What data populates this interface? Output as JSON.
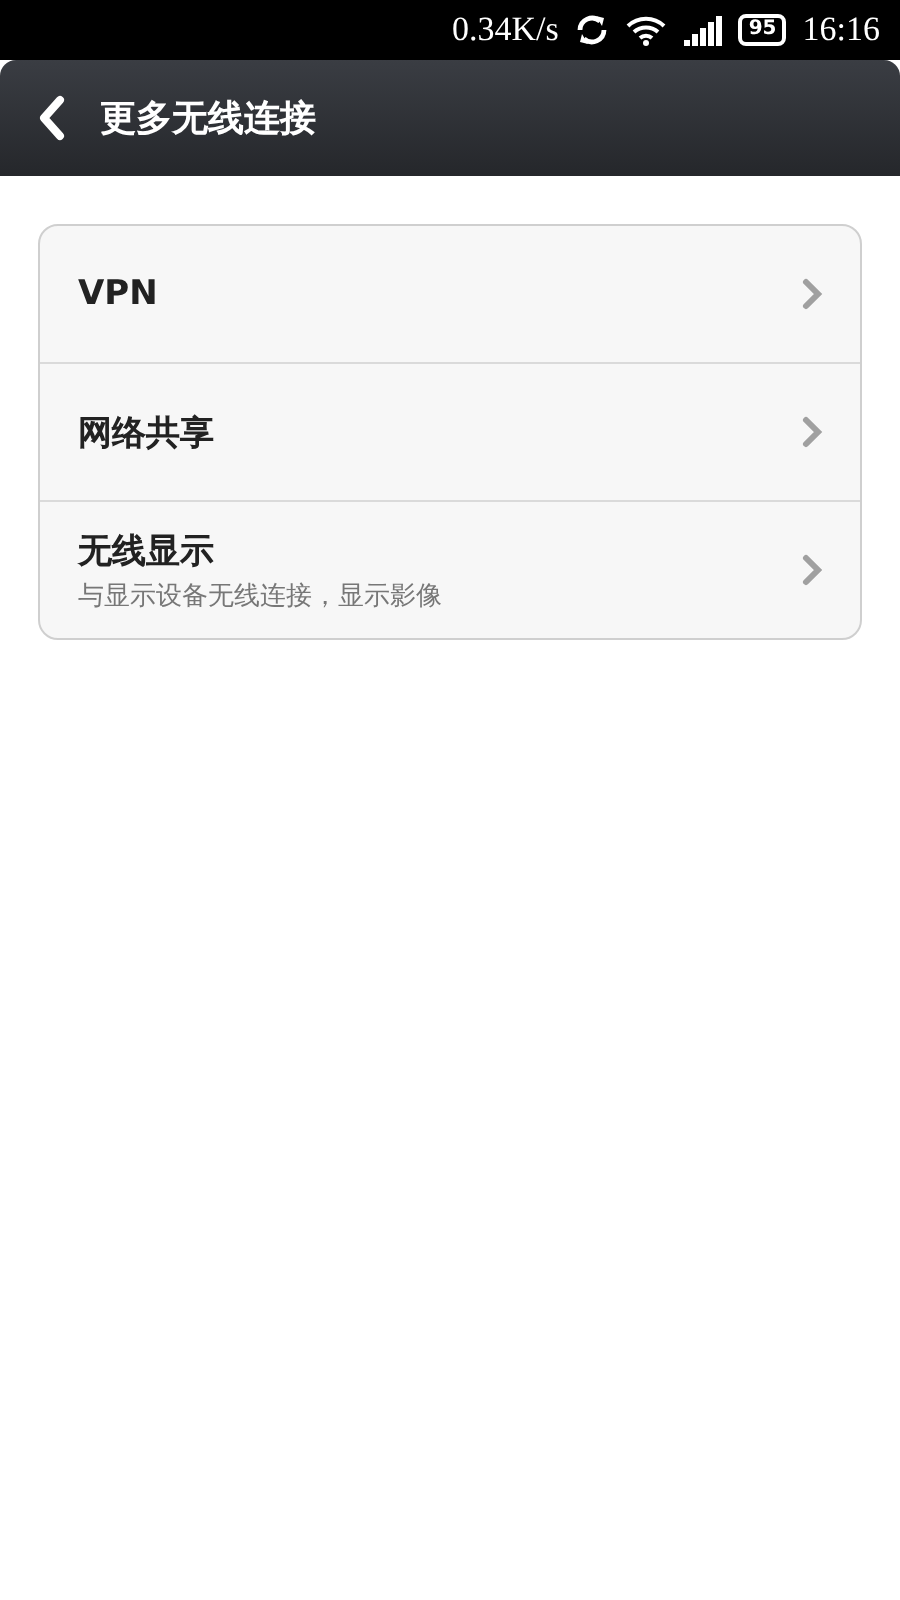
{
  "status_bar": {
    "speed": "0.34K/s",
    "battery": "95",
    "time": "16:16"
  },
  "header": {
    "title": "更多无线连接"
  },
  "items": [
    {
      "title": "VPN"
    },
    {
      "title": "网络共享"
    },
    {
      "title": "无线显示",
      "subtitle": "与显示设备无线连接，显示影像"
    }
  ]
}
